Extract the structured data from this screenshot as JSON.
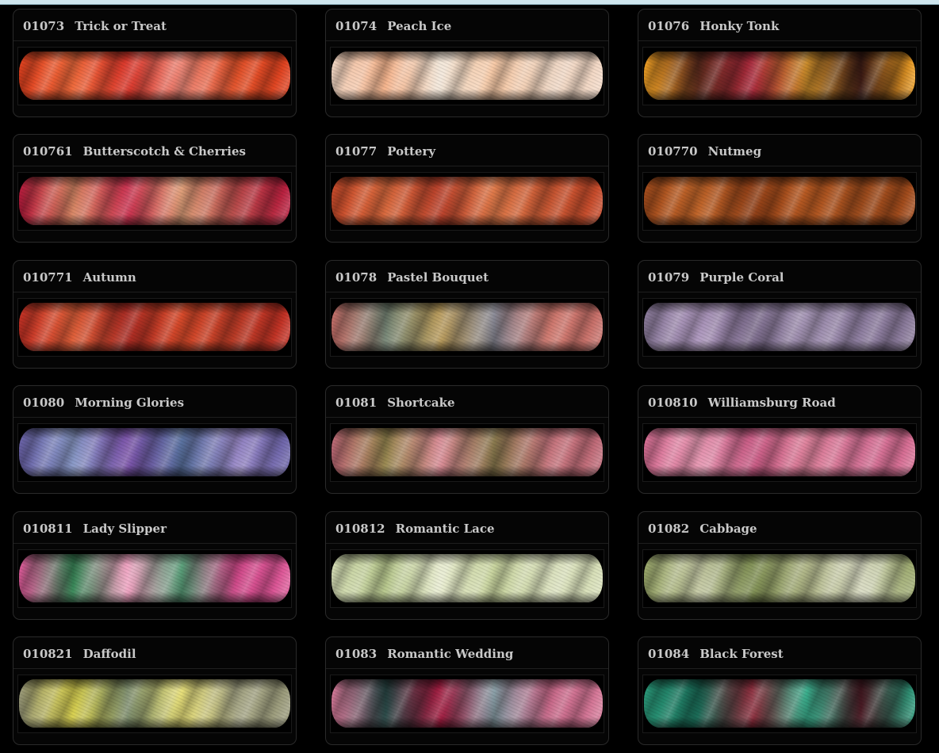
{
  "swatches": [
    {
      "code": "01073",
      "name": "Trick or Treat",
      "colors": [
        "#e0401e",
        "#ef6a3c",
        "#d9362a",
        "#f08a7a",
        "#e2532b"
      ]
    },
    {
      "code": "01074",
      "name": "Peach Ice",
      "colors": [
        "#f4d9c6",
        "#f6b58e",
        "#f2e6d8",
        "#f7c9a6",
        "#efd7c4"
      ]
    },
    {
      "code": "01076",
      "name": "Honky Tonk",
      "colors": [
        "#f0a024",
        "#5a2a1c",
        "#a8283a",
        "#c98b2a",
        "#3a1a14"
      ]
    },
    {
      "code": "010761",
      "name": "Butterscotch & Cherries",
      "colors": [
        "#b81a3c",
        "#d98866",
        "#c9304e",
        "#e0a07a",
        "#b84a4a"
      ]
    },
    {
      "code": "01077",
      "name": "Pottery",
      "colors": [
        "#c84a2a",
        "#d96a3e",
        "#b8402a",
        "#e07a4a",
        "#c65632"
      ]
    },
    {
      "code": "010770",
      "name": "Nutmeg",
      "colors": [
        "#a44c1c",
        "#c2662a",
        "#8e3e16",
        "#b85a22",
        "#9a4a1c"
      ]
    },
    {
      "code": "010771",
      "name": "Autumn",
      "colors": [
        "#c43024",
        "#e0603a",
        "#a82a22",
        "#d84a2a",
        "#b83a26"
      ]
    },
    {
      "code": "01078",
      "name": "Pastel Bouquet",
      "colors": [
        "#c8706a",
        "#7a8a7a",
        "#b89a5a",
        "#8a8a96",
        "#d07a70"
      ]
    },
    {
      "code": "01079",
      "name": "Purple Coral",
      "colors": [
        "#8a7a9a",
        "#b09ac0",
        "#7a6a8a",
        "#a696b6",
        "#8e7ea0"
      ]
    },
    {
      "code": "01080",
      "name": "Morning Glories",
      "colors": [
        "#6a62a8",
        "#8a9ac8",
        "#7a52a8",
        "#5a72a0",
        "#9a8ac8"
      ]
    },
    {
      "code": "01081",
      "name": "Shortcake",
      "colors": [
        "#c06a78",
        "#9a8a52",
        "#d88a94",
        "#8a7a4e",
        "#c87880"
      ]
    },
    {
      "code": "010810",
      "name": "Williamsburg Road",
      "colors": [
        "#d86e94",
        "#e89ab4",
        "#c85a84",
        "#e0849e",
        "#d47296"
      ]
    },
    {
      "code": "010811",
      "name": "Lady Slipper",
      "colors": [
        "#e05a9a",
        "#3a8a5a",
        "#f0a0c0",
        "#5aa07a",
        "#d04a8a"
      ]
    },
    {
      "code": "010812",
      "name": "Romantic Lace",
      "colors": [
        "#d8e0b8",
        "#b8c88e",
        "#e8ecd0",
        "#c8d49e",
        "#dce2c0"
      ]
    },
    {
      "code": "01082",
      "name": "Cabbage",
      "colors": [
        "#9aa86a",
        "#c8cca8",
        "#7e8e52",
        "#b2b88a",
        "#dadcc4"
      ]
    },
    {
      "code": "010821",
      "name": "Daffodil",
      "colors": [
        "#9a9a7a",
        "#d8d050",
        "#7a8a6a",
        "#e8e07a",
        "#a8a888"
      ]
    },
    {
      "code": "01083",
      "name": "Romantic Wedding",
      "colors": [
        "#d87a9a",
        "#2a4a48",
        "#a01a3e",
        "#8aa0a8",
        "#c86a8a"
      ]
    },
    {
      "code": "01084",
      "name": "Black Forest",
      "colors": [
        "#2a9a7a",
        "#1a6a56",
        "#8a2a3a",
        "#3ab08e",
        "#4a1a24"
      ]
    }
  ]
}
